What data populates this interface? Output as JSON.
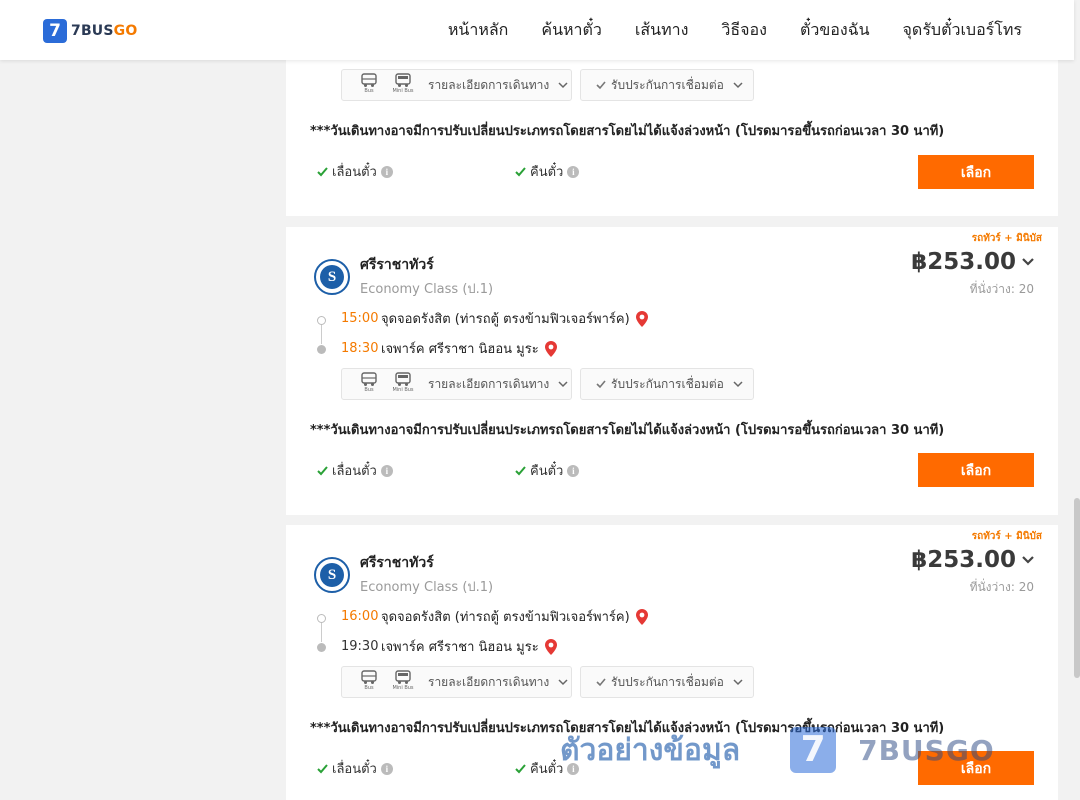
{
  "header": {
    "logo_number": "7",
    "logo_text_main": "7BUS",
    "logo_text_accent": "GO",
    "nav": [
      "หน้าหลัก",
      "ค้นหาตั๋ว",
      "เส้นทาง",
      "วิธีจอง",
      "ตั๋วของฉัน",
      "จุดรับตั๋วเบอร์โทร"
    ]
  },
  "accent_color": "#ff6a00",
  "brand_color": "#2b6cd8",
  "common": {
    "bus_label": "Bus",
    "minibus_label": "Mini Bus",
    "route_details": "รายละเอียดการเดินทาง",
    "connection_insurance": "รับประกันการเชื่อมต่อ",
    "notice": "***วันเดินทางอาจมีการปรับเปลี่ยนประเภทรถโดยสารโดยไม่ได้แจ้งล่วงหน้า (โปรดมารอขึ้นรถก่อนเวลา 30 นาที)",
    "reschedule": "เลื่อนตั๋ว",
    "refund": "คืนตั๋ว",
    "select": "เลือก",
    "info_icon": "i"
  },
  "trips": [
    {
      "tag": "รถทัวร์ + มินิบัส",
      "operator": "ศรีราชาทัวร์",
      "class": "Economy Class (ป.1)",
      "price": "฿253.00",
      "seats": "ที่นั่งว่าง: 20",
      "depart_time": "15:00",
      "depart_stop": "จุดจอดรังสิต (ท่ารถตู้ ตรงข้ามฟิวเจอร์พาร์ค)",
      "arrive_time": "18:30",
      "arrive_stop": "เจพาร์ค ศรีราชา นิฮอน มูระ"
    },
    {
      "tag": "รถทัวร์ + มินิบัส",
      "operator": "ศรีราชาทัวร์",
      "class": "Economy Class (ป.1)",
      "price": "฿253.00",
      "seats": "ที่นั่งว่าง: 20",
      "depart_time": "16:00",
      "depart_stop": "จุดจอดรังสิต (ท่ารถตู้ ตรงข้ามฟิวเจอร์พาร์ค)",
      "arrive_time": "19:30",
      "arrive_stop": "เจพาร์ค ศรีราชา นิฮอน มูระ"
    }
  ],
  "watermark": {
    "text": "ตัวอย่างข้อมูล",
    "badge": "7",
    "brand": "7BUSGO"
  }
}
